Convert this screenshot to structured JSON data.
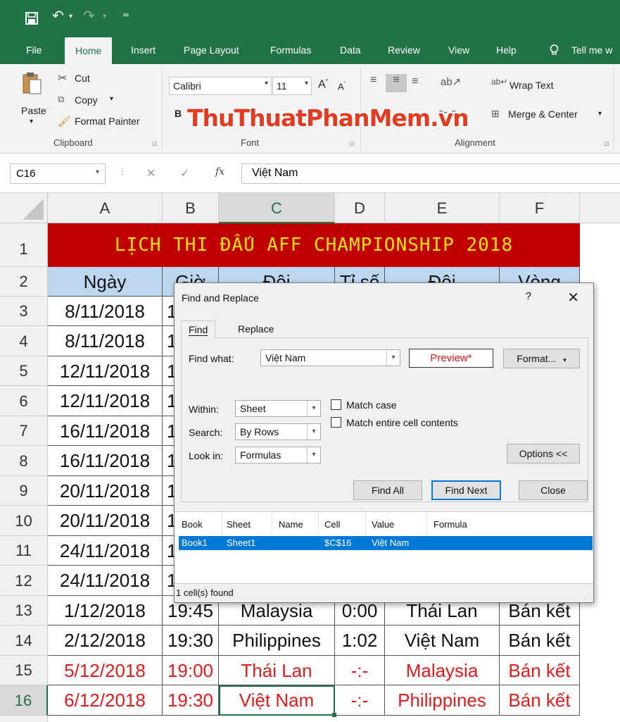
{
  "qat": {
    "save_icon": "save-icon",
    "undo_icon": "undo-icon",
    "redo_icon": "redo-icon",
    "customize_icon": "customize-icon"
  },
  "ribbon_tabs": [
    "File",
    "Home",
    "Insert",
    "Page Layout",
    "Formulas",
    "Data",
    "Review",
    "View",
    "Help",
    "Tell me w"
  ],
  "clipboard": {
    "paste": "Paste",
    "cut": "Cut",
    "copy": "Copy",
    "format_painter": "Format Painter",
    "label": "Clipboard"
  },
  "font": {
    "name": "Calibri",
    "size": "11",
    "label": "Font",
    "bold": "B"
  },
  "alignment": {
    "wrap_text": "Wrap Text",
    "merge_center": "Merge & Center",
    "label": "Alignment"
  },
  "watermark": "ThuThuatPhanMem.vn",
  "formula_bar": {
    "name_box": "C16",
    "fx": "fx",
    "value": "Việt Nam"
  },
  "columns": [
    "A",
    "B",
    "C",
    "D",
    "E",
    "F"
  ],
  "sheet": {
    "title": "LỊCH THI ĐẤU AFF CHAMPIONSHIP 2018",
    "headers_visible": [
      "Ngày",
      "Giờ",
      "Đội",
      "Tỉ số",
      "Đội",
      "Vòng"
    ],
    "rows_partial": [
      {
        "row": "3",
        "a": "8/11/2018",
        "b": "1"
      },
      {
        "row": "4",
        "a": "8/11/2018",
        "b": "1"
      },
      {
        "row": "5",
        "a": "12/11/2018",
        "b": "1"
      },
      {
        "row": "6",
        "a": "12/11/2018",
        "b": "1"
      },
      {
        "row": "7",
        "a": "16/11/2018",
        "b": "1"
      },
      {
        "row": "8",
        "a": "16/11/2018",
        "b": "1"
      },
      {
        "row": "9",
        "a": "20/11/2018",
        "b": "1"
      },
      {
        "row": "10",
        "a": "20/11/2018",
        "b": "1"
      },
      {
        "row": "11",
        "a": "24/11/2018",
        "b": "1"
      },
      {
        "row": "12",
        "a": "24/11/2018",
        "b": "1"
      }
    ],
    "rows_full": [
      {
        "row": "13",
        "a": "1/12/2018",
        "b": "19:45",
        "c": "Malaysia",
        "d": "0:00",
        "e": "Thái Lan",
        "f": "Bán kết",
        "red": false
      },
      {
        "row": "14",
        "a": "2/12/2018",
        "b": "19:30",
        "c": "Philippines",
        "d": "1:02",
        "e": "Việt Nam",
        "f": "Bán kết",
        "red": false
      },
      {
        "row": "15",
        "a": "5/12/2018",
        "b": "19:00",
        "c": "Thái Lan",
        "d": "-:-",
        "e": "Malaysia",
        "f": "Bán kết",
        "red": true
      },
      {
        "row": "16",
        "a": "6/12/2018",
        "b": "19:30",
        "c": "Việt Nam",
        "d": "-:-",
        "e": "Philippines",
        "f": "Bán kết",
        "red": true
      }
    ]
  },
  "dialog": {
    "title": "Find and Replace",
    "help": "?",
    "close": "✕",
    "tab_find": "Find",
    "tab_replace": "Replace",
    "find_what_label": "Find what:",
    "find_what_value": "Việt Nam",
    "preview": "Preview*",
    "format_button": "Format...",
    "within_label": "Within:",
    "within_value": "Sheet",
    "search_label": "Search:",
    "search_value": "By Rows",
    "lookin_label": "Look in:",
    "lookin_value": "Formulas",
    "match_case": "Match case",
    "match_entire": "Match entire cell contents",
    "options_button": "Options <<",
    "find_all": "Find All",
    "find_next": "Find Next",
    "close_button": "Close",
    "result_columns": [
      "Book",
      "Sheet",
      "Name",
      "Cell",
      "Value",
      "Formula"
    ],
    "result_row": {
      "book": "Book1",
      "sheet": "Sheet1",
      "name": "",
      "cell": "$C$16",
      "value": "Việt Nam",
      "formula": ""
    },
    "status": "1 cell(s) found"
  },
  "colors": {
    "excel_green": "#217346",
    "title_bg": "#c00000",
    "title_fg": "#ffe600",
    "header_bg": "#bdd7ee",
    "red_text": "#e01b1b",
    "select_blue": "#0078d7"
  }
}
